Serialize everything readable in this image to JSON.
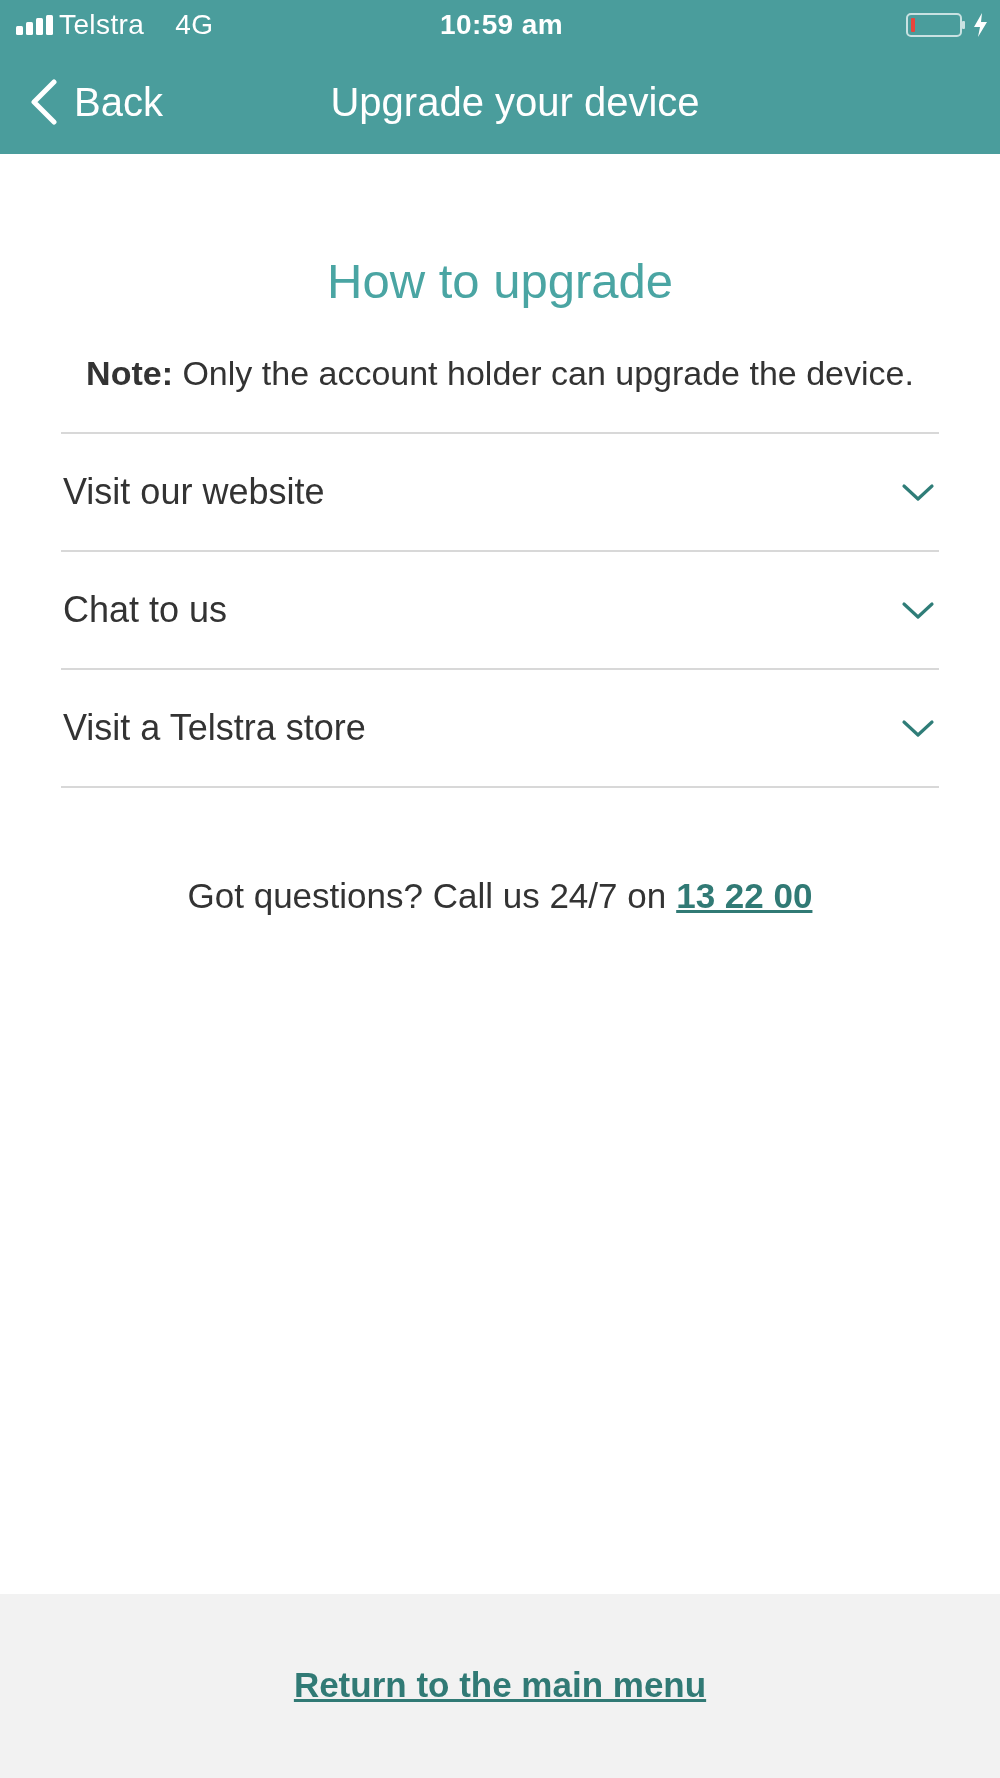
{
  "status_bar": {
    "carrier": "Telstra",
    "network": "4G",
    "time": "10:59 am"
  },
  "nav_bar": {
    "back_label": "Back",
    "title": "Upgrade your device"
  },
  "content": {
    "heading": "How to upgrade",
    "note": "**Note:** Only the account holder can upgrade the device."
  },
  "accordion": [
    {
      "label": "Visit our website",
      "expanded": false
    },
    {
      "label": "Chat to us",
      "expanded": false
    },
    {
      "label": "Visit a Telstra store",
      "expanded": false
    }
  ],
  "contact": {
    "text": "Got questions? Call us 24/7 on",
    "phone": "13 22 00"
  },
  "footer": {
    "link": "Return to the main menu"
  }
}
